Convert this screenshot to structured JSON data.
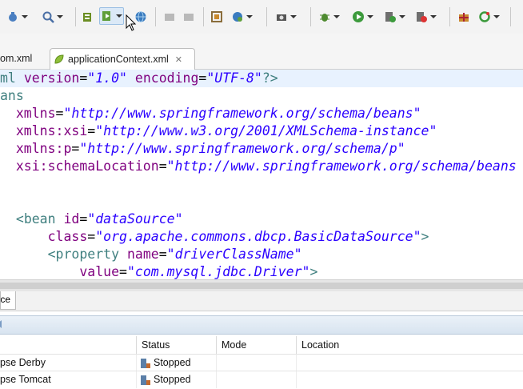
{
  "toolbar": {
    "icons": [
      "debug-icon",
      "search-icon",
      "server-icon",
      "run-icon",
      "globe-icon",
      "back-icon",
      "forward-icon",
      "external-tools-icon",
      "web-icon",
      "camera-icon",
      "bug-icon",
      "run-play-icon",
      "run-config-icon",
      "stop-icon",
      "package-icon",
      "refresh-icon"
    ]
  },
  "tabs": {
    "inactive_label": "om.xml",
    "active_label": "applicationContext.xml",
    "close_glyph": "✕"
  },
  "editor": {
    "lines": [
      {
        "pi1": "ml ",
        "a1": "version",
        "eq1": "=",
        "v1": "\"1.0\"",
        "sp": " ",
        "a2": "encoding",
        "eq2": "=",
        "v2": "\"UTF-8\"",
        "pi2": "?>"
      },
      {
        "tag": "ans"
      },
      {
        "a": "  xmlns",
        "eq": "=",
        "v": "\"http://www.springframework.org/schema/beans\""
      },
      {
        "a": "  xmlns:xsi",
        "eq": "=",
        "v": "\"http://www.w3.org/2001/XMLSchema-instance\""
      },
      {
        "a": "  xmlns:p",
        "eq": "=",
        "v": "\"http://www.springframework.org/schema/p\""
      },
      {
        "a": "  xsi:schemaLocation",
        "eq": "=",
        "v": "\"http://www.springframework.org/schema/beans h"
      },
      {
        "blank": ""
      },
      {
        "lt": "  <",
        "tag": "bean",
        "sp": " ",
        "a": "id",
        "eq": "=",
        "v": "\"dataSource\""
      },
      {
        "a": "      class",
        "eq": "=",
        "v": "\"org.apache.commons.dbcp.BasicDataSource\"",
        "gt": ">"
      },
      {
        "lt": "      <",
        "tag": "property",
        "sp": " ",
        "a": "name",
        "eq": "=",
        "v": "\"driverClassName\""
      },
      {
        "a": "          value",
        "eq": "=",
        "v": "\"com.mysql.jdbc.Driver\"",
        "gt": ">"
      }
    ]
  },
  "editor_tabs": {
    "source_label": "ource"
  },
  "servers": {
    "columns": [
      "",
      "Status",
      "Mode",
      "Location"
    ],
    "rows": [
      {
        "name": "pse Derby",
        "status": "Stopped",
        "mode": "",
        "location": ""
      },
      {
        "name": "pse Tomcat",
        "status": "Stopped",
        "mode": "",
        "location": ""
      }
    ]
  },
  "colors": {
    "tag": "#3f7f7f",
    "attribute": "#7f007f",
    "value": "#2a00ff",
    "line_highlight": "#e8f2fe"
  }
}
